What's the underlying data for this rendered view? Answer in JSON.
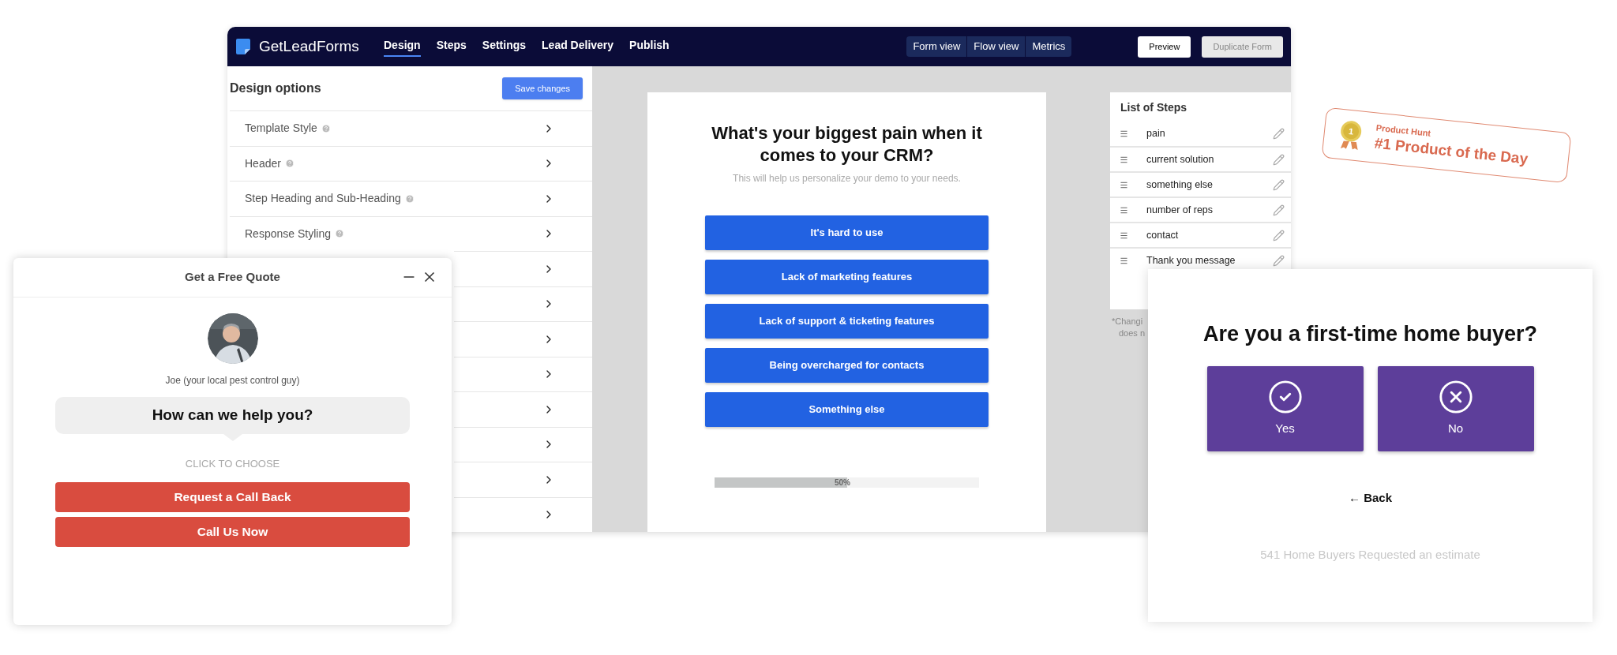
{
  "app": {
    "logo": "GetLeadForms",
    "nav": [
      {
        "label": "Design",
        "selected": true
      },
      {
        "label": "Steps",
        "selected": false
      },
      {
        "label": "Settings",
        "selected": false
      },
      {
        "label": "Lead Delivery",
        "selected": false
      },
      {
        "label": "Publish",
        "selected": false
      }
    ],
    "views": [
      {
        "label": "Form view"
      },
      {
        "label": "Flow view"
      },
      {
        "label": "Metrics"
      }
    ],
    "buttons": [
      {
        "label": "Preview",
        "disabled": false
      },
      {
        "label": "Duplicate Form",
        "disabled": true
      }
    ]
  },
  "design_panel": {
    "title": "Design options",
    "save_button": "Save changes",
    "options": [
      {
        "kind": "row",
        "label": "Template Style",
        "help": true
      },
      {
        "kind": "row",
        "label": "Header",
        "help": true
      },
      {
        "kind": "row",
        "label": "Step Heading and Sub-Heading",
        "help": true
      },
      {
        "kind": "row",
        "label": "Response Styling",
        "help": true
      },
      {
        "kind": "covered"
      },
      {
        "kind": "covered"
      },
      {
        "kind": "covered"
      },
      {
        "kind": "covered"
      },
      {
        "kind": "covered"
      },
      {
        "kind": "covered"
      },
      {
        "kind": "covered"
      },
      {
        "kind": "covered"
      }
    ]
  },
  "form_preview": {
    "title": "What's your biggest pain when it comes to your CRM?",
    "subtitle": "This will help us personalize your demo to your needs.",
    "answers": [
      "It's hard to use",
      "Lack of marketing features",
      "Lack of support & ticketing features",
      "Being overcharged for contacts",
      "Something else"
    ],
    "progress": {
      "level": 0.5,
      "label": "50%"
    }
  },
  "steps": {
    "title": "List of Steps",
    "items": [
      "pain",
      "current solution",
      "something else",
      "number of reps",
      "contact",
      "Thank you message"
    ],
    "footnote": [
      "*Changi",
      "does n"
    ]
  },
  "badge": {
    "medal": "1",
    "kicker": "Product Hunt",
    "title": "#1 Product of the Day"
  },
  "quote_widget": {
    "title": "Get a Free Quote",
    "agent": "Joe (your local pest control guy)",
    "question": "How can we help you?",
    "prompt": "CLICK TO CHOOSE",
    "actions": [
      "Request a Call Back",
      "Call Us Now"
    ]
  },
  "home_buyer": {
    "title": "Are you a first-time home buyer?",
    "options": [
      {
        "kind": "yes",
        "label": "Yes"
      },
      {
        "kind": "no",
        "label": "No"
      }
    ],
    "back": "← Back",
    "footer": "541 Home Buyers Requested an estimate"
  }
}
